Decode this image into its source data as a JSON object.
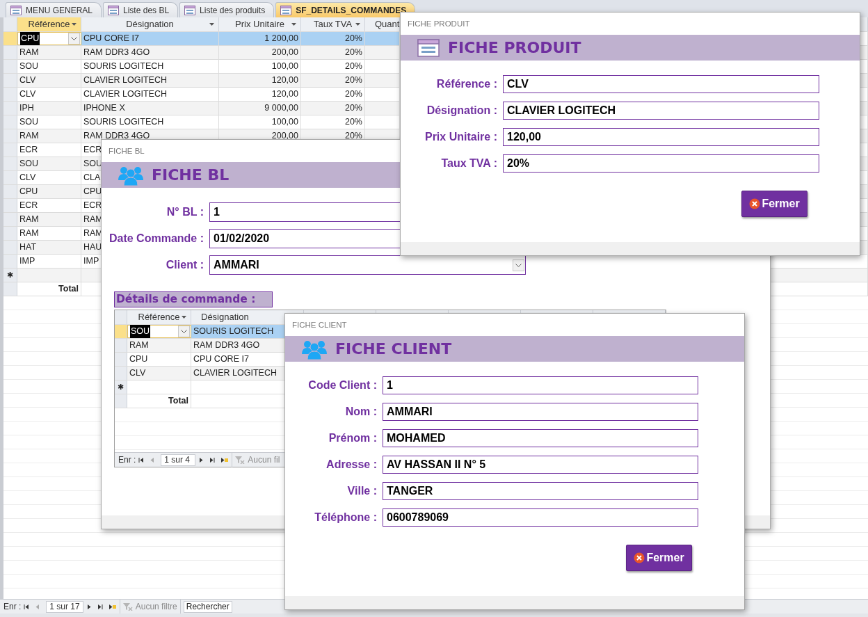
{
  "tabs": [
    {
      "label": "MENU GENERAL",
      "selected": false
    },
    {
      "label": "Liste des BL",
      "selected": false
    },
    {
      "label": "Liste des produits",
      "selected": false
    },
    {
      "label": "SF_DETAILS_COMMANDES",
      "selected": true
    }
  ],
  "datasheet": {
    "columns": [
      {
        "label": "Référence",
        "kind": "text",
        "selected": true,
        "dropdown": true
      },
      {
        "label": "Désignation",
        "kind": "text",
        "selected": false,
        "dropdown": true
      },
      {
        "label": "Prix Unitaire",
        "kind": "number",
        "selected": false,
        "dropdown": true
      },
      {
        "label": "Taux TVA",
        "kind": "number",
        "selected": false,
        "dropdown": true
      },
      {
        "label": "Quant",
        "selected": false,
        "dropdown": false
      }
    ],
    "rows": [
      {
        "cells": [
          "CPU",
          "CPU CORE I7",
          "1 200,00",
          "20%"
        ],
        "selected": true
      },
      {
        "cells": [
          "RAM",
          "RAM DDR3 4GO",
          "200,00",
          "20%"
        ],
        "selected": false
      },
      {
        "cells": [
          "SOU",
          "SOURIS LOGITECH",
          "100,00",
          "20%"
        ],
        "selected": false
      },
      {
        "cells": [
          "CLV",
          "CLAVIER LOGITECH",
          "120,00",
          "20%"
        ],
        "selected": false
      },
      {
        "cells": [
          "CLV",
          "CLAVIER LOGITECH",
          "120,00",
          "20%"
        ],
        "selected": false
      },
      {
        "cells": [
          "IPH",
          "IPHONE X",
          "9 000,00",
          "20%"
        ],
        "selected": false
      },
      {
        "cells": [
          "SOU",
          "SOURIS LOGITECH",
          "100,00",
          "20%"
        ],
        "selected": false
      },
      {
        "cells": [
          "RAM",
          "RAM DDR3 4GO",
          "200,00",
          "20%"
        ],
        "selected": false
      },
      {
        "cells": [
          "ECR",
          "ECR"
        ],
        "selected": false
      },
      {
        "cells": [
          "SOU",
          "SOU"
        ],
        "selected": false
      },
      {
        "cells": [
          "CLV",
          "CLA"
        ],
        "selected": false
      },
      {
        "cells": [
          "CPU",
          "CPU"
        ],
        "selected": false
      },
      {
        "cells": [
          "ECR",
          "ECR"
        ],
        "selected": false
      },
      {
        "cells": [
          "RAM",
          "RAM"
        ],
        "selected": false
      },
      {
        "cells": [
          "RAM",
          "RAM"
        ],
        "selected": false
      },
      {
        "cells": [
          "HAT",
          "HAU"
        ],
        "selected": false
      },
      {
        "cells": [
          "IMP",
          "IMP"
        ],
        "selected": false
      }
    ],
    "new_row_marker": "✱",
    "total_label": "Total"
  },
  "status_bar": {
    "record_label": "Enr :",
    "record": "1 sur 17",
    "filter": "Aucun filtre",
    "search_placeholder": "Rechercher"
  },
  "fiche_bl": {
    "caption": "FICHE BL",
    "title": "FICHE BL",
    "fields": [
      {
        "label": "N° BL :",
        "value": "1",
        "kind": "text"
      },
      {
        "label": "Date Commande :",
        "value": "01/02/2020",
        "kind": "text"
      },
      {
        "label": "Client :",
        "value": "AMMARI",
        "kind": "combo"
      }
    ],
    "details_label": "Détails de commande :",
    "subform": {
      "columns": [
        {
          "label": "Référence",
          "kind": "text",
          "selected": false,
          "dropdown": true
        },
        {
          "label": "Désignation",
          "kind": "text",
          "selected": false,
          "dropdown": false
        }
      ],
      "rows": [
        {
          "cells": [
            "SOU",
            "SOURIS LOGITECH"
          ],
          "selected": true
        },
        {
          "cells": [
            "RAM",
            "RAM DDR3 4GO"
          ],
          "selected": false
        },
        {
          "cells": [
            "CPU",
            "CPU CORE I7"
          ],
          "selected": false
        },
        {
          "cells": [
            "CLV",
            "CLAVIER LOGITECH"
          ],
          "selected": false
        }
      ],
      "new_row_marker": "✱",
      "total_label": "Total",
      "nav": {
        "record_label": "Enr :",
        "record": "1 sur 4",
        "filter": "Aucun fil"
      }
    }
  },
  "fiche_produit": {
    "caption": "FICHE PRODUIT",
    "title": "FICHE PRODUIT",
    "fields": [
      {
        "label": "Référence :",
        "value": "CLV",
        "kind": "text"
      },
      {
        "label": "Désignation :",
        "value": "CLAVIER LOGITECH",
        "kind": "text"
      },
      {
        "label": "Prix Unitaire :",
        "value": "120,00",
        "kind": "text"
      },
      {
        "label": "Taux TVA :",
        "value": "20%",
        "kind": "text"
      }
    ],
    "button": "Fermer"
  },
  "fiche_client": {
    "caption": "FICHE CLIENT",
    "title": "FICHE CLIENT",
    "fields": [
      {
        "label": "Code Client :",
        "value": "1",
        "kind": "text"
      },
      {
        "label": "Nom :",
        "value": "AMMARI",
        "kind": "text"
      },
      {
        "label": "Prénom :",
        "value": "MOHAMED",
        "kind": "text"
      },
      {
        "label": "Adresse :",
        "value": "AV HASSAN II N° 5",
        "kind": "text"
      },
      {
        "label": "Ville :",
        "value": "TANGER",
        "kind": "text"
      },
      {
        "label": "Téléphone :",
        "value": "0600789069",
        "kind": "text"
      }
    ],
    "button": "Fermer"
  }
}
